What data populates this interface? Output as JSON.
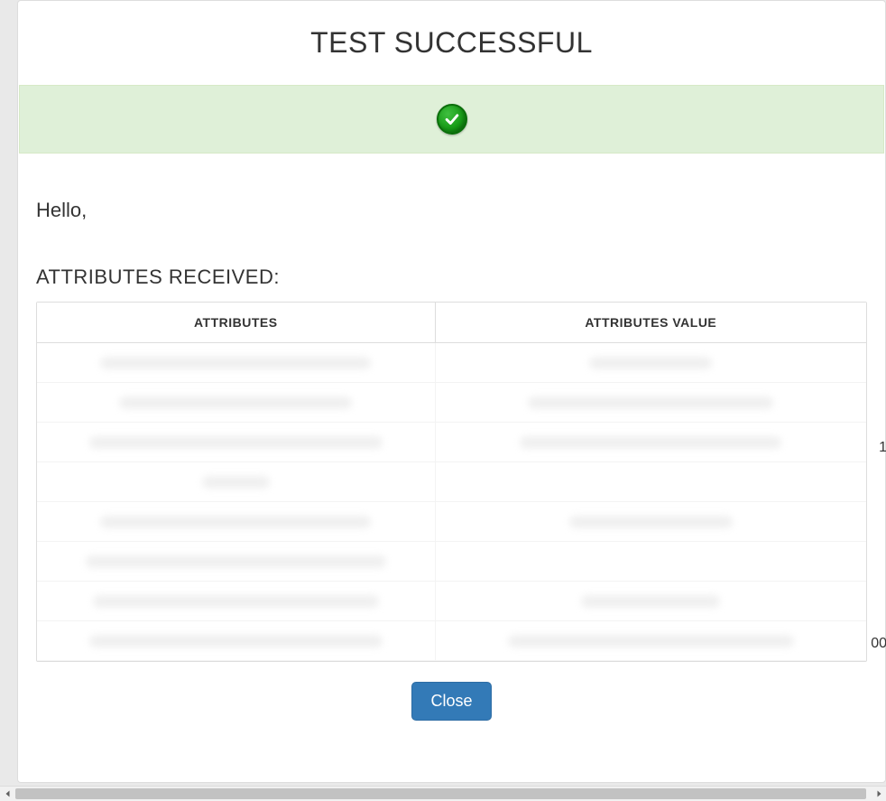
{
  "header": {
    "title": "TEST SUCCESSFUL"
  },
  "status": {
    "icon_name": "check-circle-icon"
  },
  "body": {
    "greeting": "Hello,",
    "heading": "ATTRIBUTES RECEIVED:"
  },
  "table": {
    "columns": [
      "ATTRIBUTES",
      "ATTRIBUTES VALUE"
    ],
    "rows": [
      {
        "attr": "",
        "value": ""
      },
      {
        "attr": "",
        "value": ""
      },
      {
        "attr": "",
        "value": ""
      },
      {
        "attr": "",
        "value": ""
      },
      {
        "attr": "",
        "value": ""
      },
      {
        "attr": "",
        "value": ""
      },
      {
        "attr": "",
        "value": ""
      },
      {
        "attr": "",
        "value": ""
      }
    ]
  },
  "footer": {
    "close_label": "Close"
  }
}
